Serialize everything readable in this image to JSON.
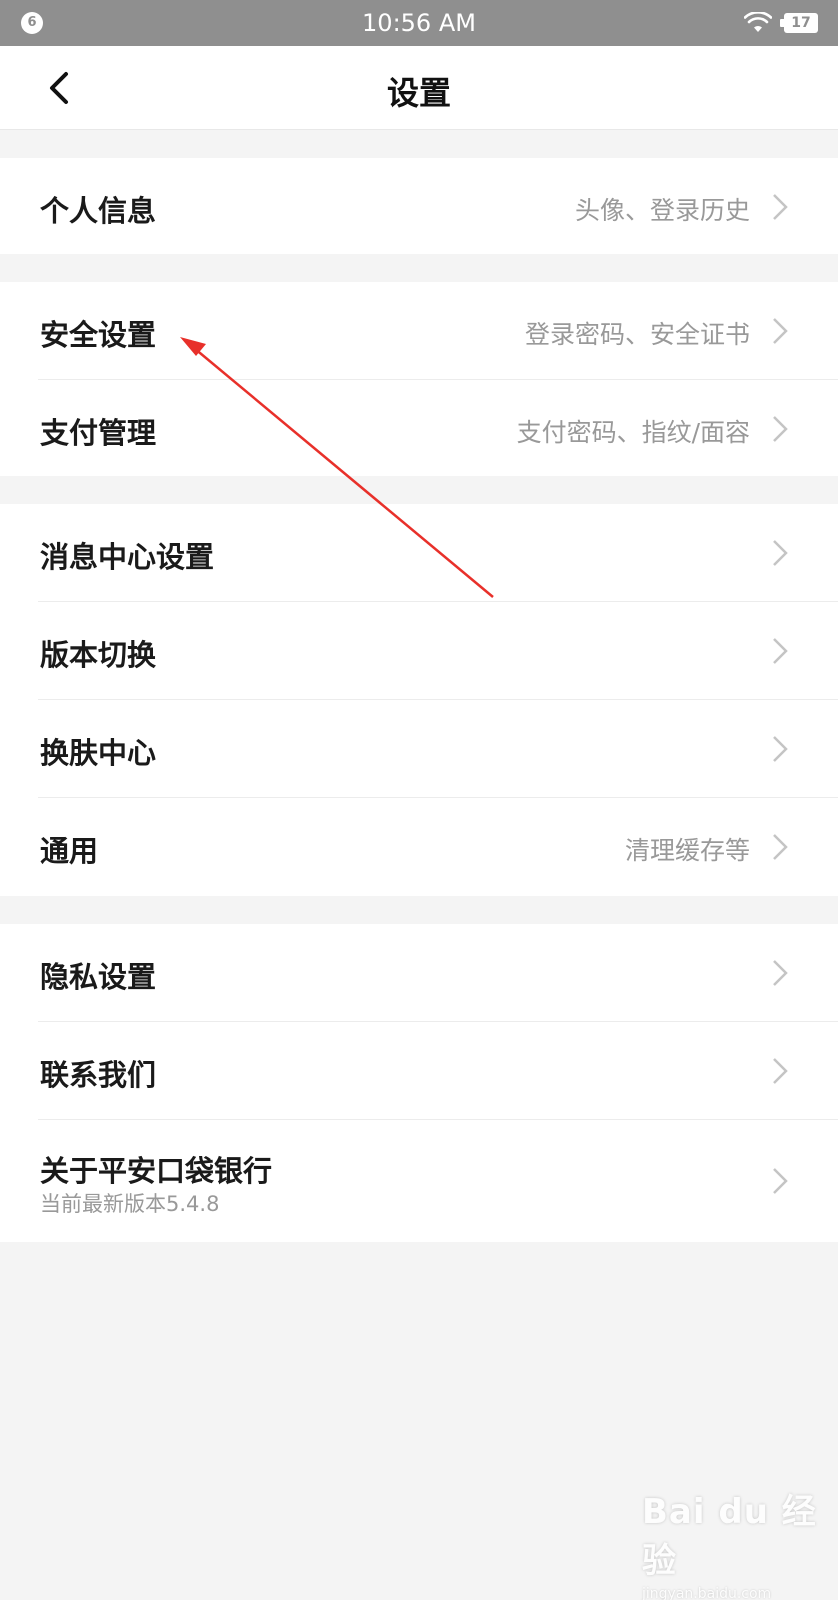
{
  "status_bar": {
    "notification_count": "6",
    "time": "10:56 AM",
    "battery": "17"
  },
  "nav": {
    "title": "设置"
  },
  "groups": [
    {
      "items": [
        {
          "label": "个人信息",
          "hint": "头像、登录历史"
        }
      ]
    },
    {
      "items": [
        {
          "label": "安全设置",
          "hint": "登录密码、安全证书"
        },
        {
          "label": "支付管理",
          "hint": "支付密码、指纹/面容"
        }
      ]
    },
    {
      "items": [
        {
          "label": "消息中心设置",
          "hint": ""
        },
        {
          "label": "版本切换",
          "hint": ""
        },
        {
          "label": "换肤中心",
          "hint": ""
        },
        {
          "label": "通用",
          "hint": "清理缓存等"
        }
      ]
    },
    {
      "items": [
        {
          "label": "隐私设置",
          "hint": ""
        },
        {
          "label": "联系我们",
          "hint": ""
        },
        {
          "label": "关于平安口袋银行",
          "hint": "",
          "sub": "当前最新版本5.4.8"
        }
      ]
    }
  ],
  "watermark": {
    "logo": "Bai du 经验",
    "url": "jingyan.baidu.com"
  },
  "colors": {
    "status_bar": "#8f8f8f",
    "annotation_arrow": "#e8302a",
    "background": "#f4f4f4"
  }
}
